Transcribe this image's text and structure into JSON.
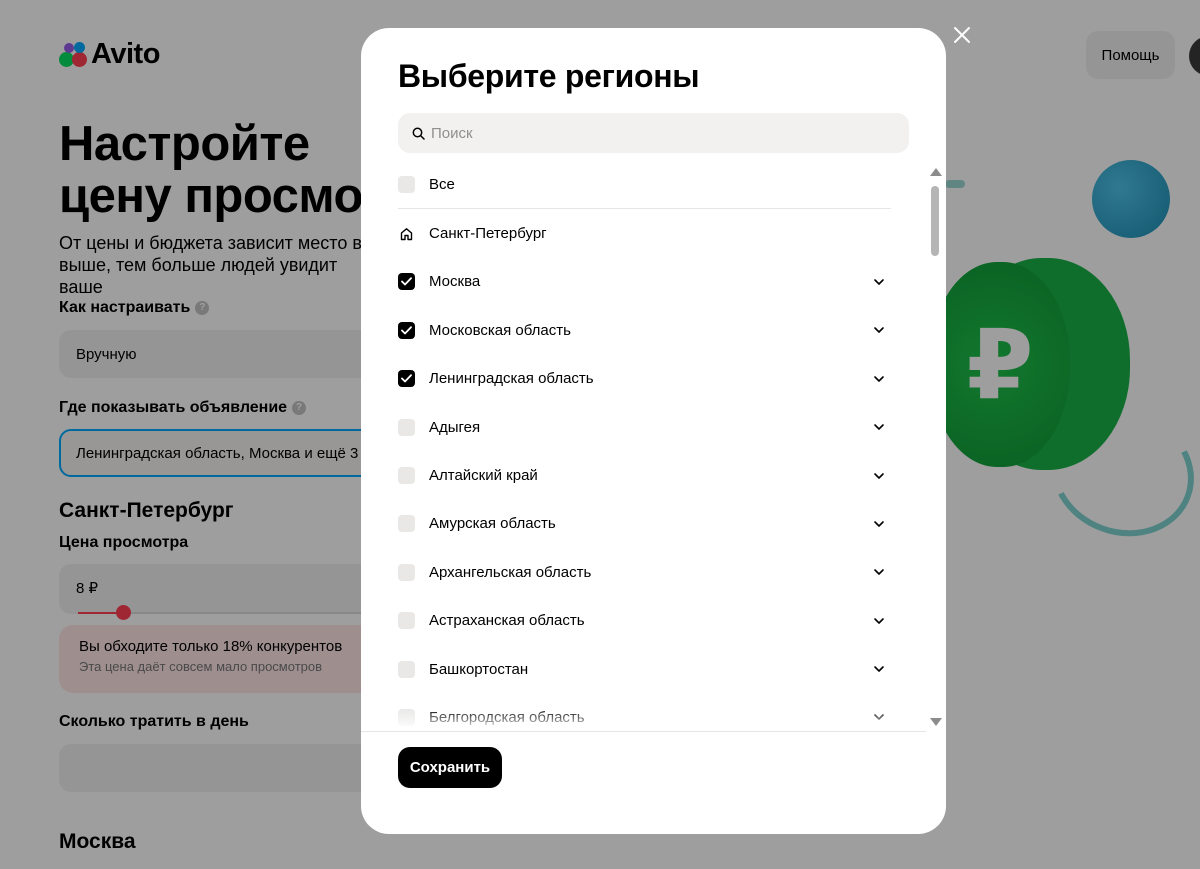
{
  "header": {
    "logo_text": "Avito",
    "help_label": "Помощь"
  },
  "hero": {
    "title": "Настройте\nцену просмот",
    "subtitle": "От цены и бюджета зависит место в п выше, тем больше людей увидит ваше"
  },
  "form": {
    "how_label": "Как настраивать",
    "how_value": "Вручную",
    "where_label": "Где показывать объявление",
    "where_value": "Ленинградская область, Москва и ещё 3",
    "section_spb": "Санкт-Петербург",
    "price_label": "Цена просмотра",
    "price_value": "8 ₽",
    "price_progress": 0.15,
    "warning_title": "Вы обходите только 18% конкурентов",
    "warning_sub": "Эта цена даёт совсем мало просмотров",
    "daily_label": "Сколько тратить в день",
    "section_moscow": "Москва"
  },
  "modal": {
    "title": "Выберите регионы",
    "search_placeholder": "Поиск",
    "all_label": "Все",
    "home_region": "Санкт-Петербург",
    "regions": [
      {
        "label": "Москва",
        "checked": true
      },
      {
        "label": "Московская область",
        "checked": true
      },
      {
        "label": "Ленинградская область",
        "checked": true
      },
      {
        "label": "Адыгея",
        "checked": false
      },
      {
        "label": "Алтайский край",
        "checked": false
      },
      {
        "label": "Амурская область",
        "checked": false
      },
      {
        "label": "Архангельская область",
        "checked": false
      },
      {
        "label": "Астраханская область",
        "checked": false
      },
      {
        "label": "Башкортостан",
        "checked": false
      },
      {
        "label": "Белгородская область",
        "checked": false
      }
    ],
    "save_label": "Сохранить"
  },
  "icons": {
    "close": "close-icon",
    "search": "search-icon",
    "home": "home-icon",
    "chevron": "chevron-down-icon",
    "check": "checkmark-icon",
    "help": "question-icon"
  },
  "colors": {
    "accent_blue": "#00aaff",
    "warning_red": "#ff4053",
    "primary_black": "#000000",
    "field_bg": "#f2f1f0"
  }
}
